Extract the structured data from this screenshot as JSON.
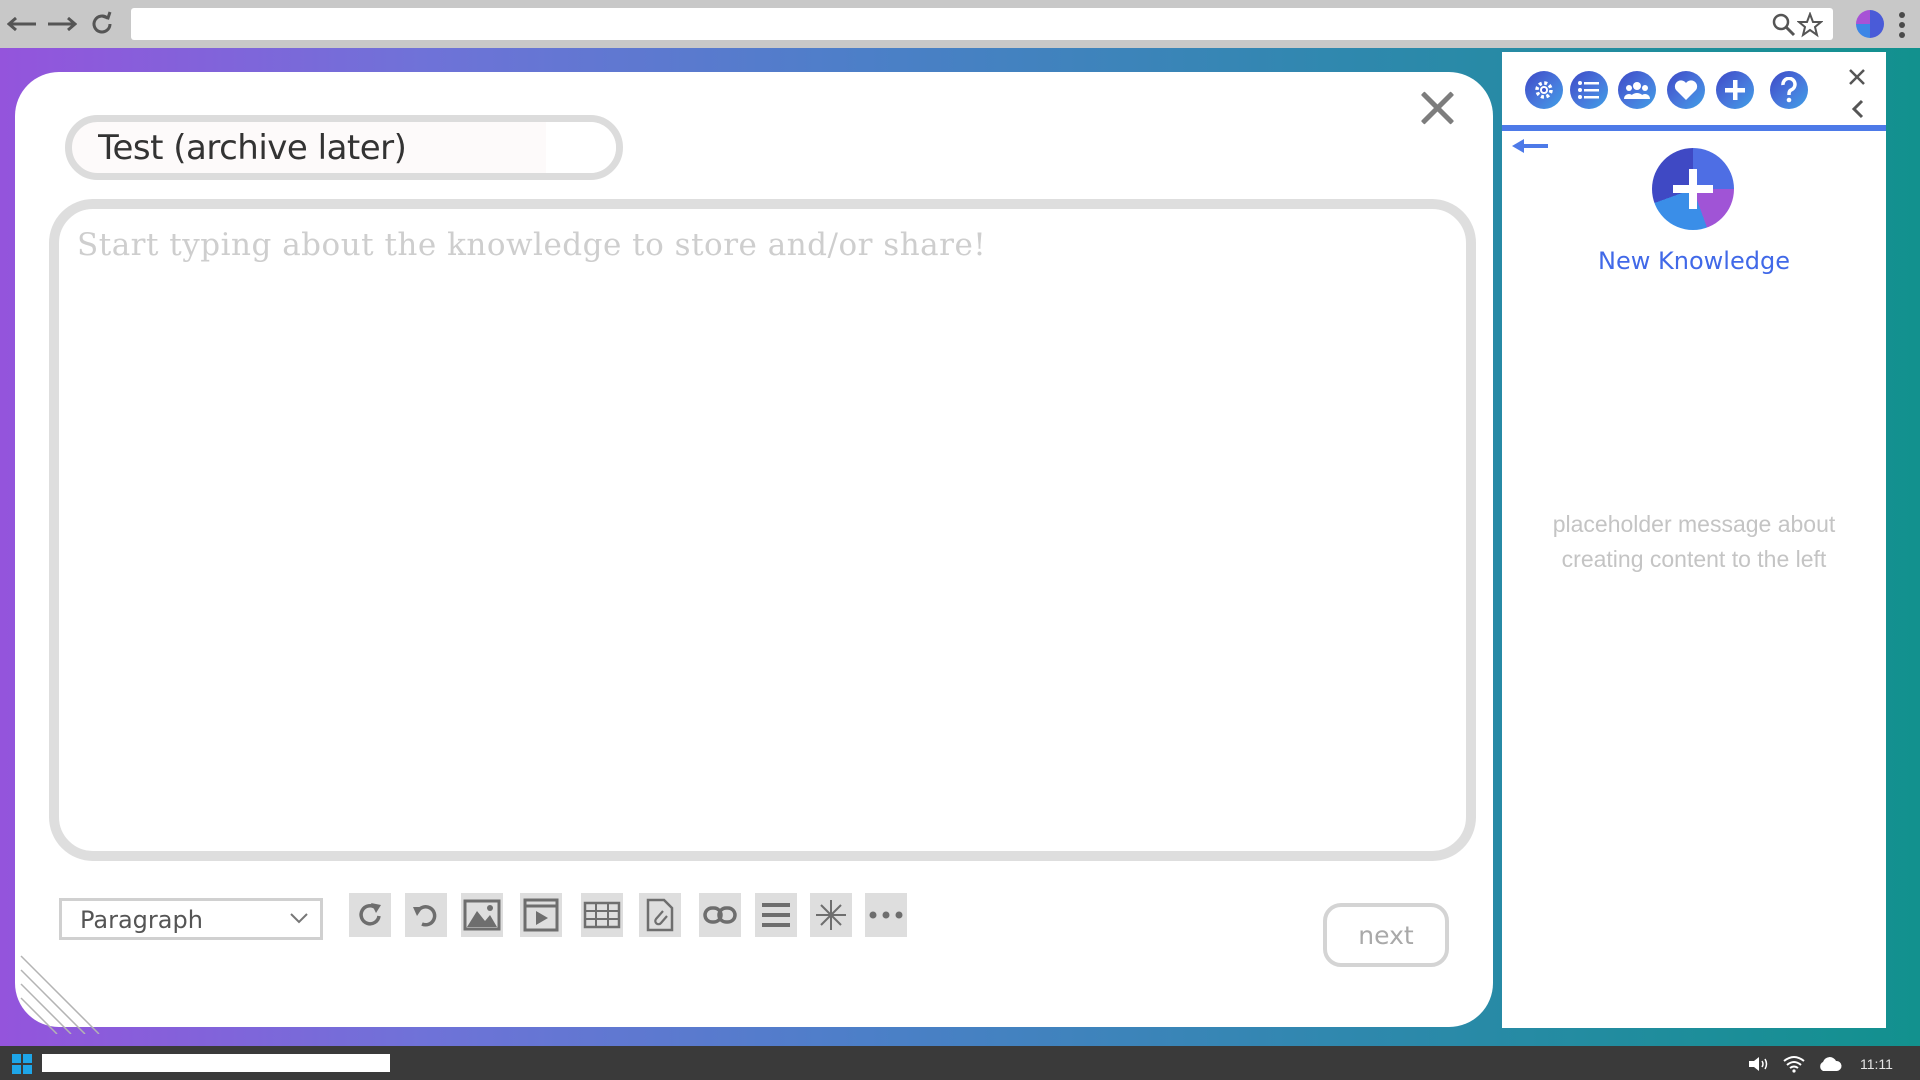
{
  "browser": {
    "url": "",
    "icons": [
      "back-arrow-icon",
      "forward-arrow-icon",
      "reload-icon",
      "search-icon",
      "bookmark-star-icon",
      "profile-icon",
      "kebab-menu-icon"
    ]
  },
  "editor": {
    "title_value": "Test (archive later)",
    "body_placeholder": "Start typing about the knowledge to store and/or share!",
    "format_select": {
      "selected": "Paragraph"
    },
    "toolbar": [
      "redo-icon",
      "undo-icon",
      "image-icon",
      "video-icon",
      "table-icon",
      "attachment-icon",
      "link-icon",
      "horizontal-rule-icon",
      "special-character-icon",
      "more-icon"
    ],
    "next_label": "next"
  },
  "side_panel": {
    "tabs": [
      "settings-icon",
      "list-icon",
      "group-icon",
      "favorites-heart-icon",
      "add-icon",
      "help-icon"
    ],
    "new_knowledge_label": "New Knowledge",
    "placeholder_message": "placeholder message about creating content to the left"
  },
  "taskbar": {
    "clock": "11:11"
  },
  "colors": {
    "accent": "#4169e8",
    "gradient_start": "#9454dc",
    "gradient_end": "#12918e",
    "taskbar": "#3a3a3a"
  }
}
